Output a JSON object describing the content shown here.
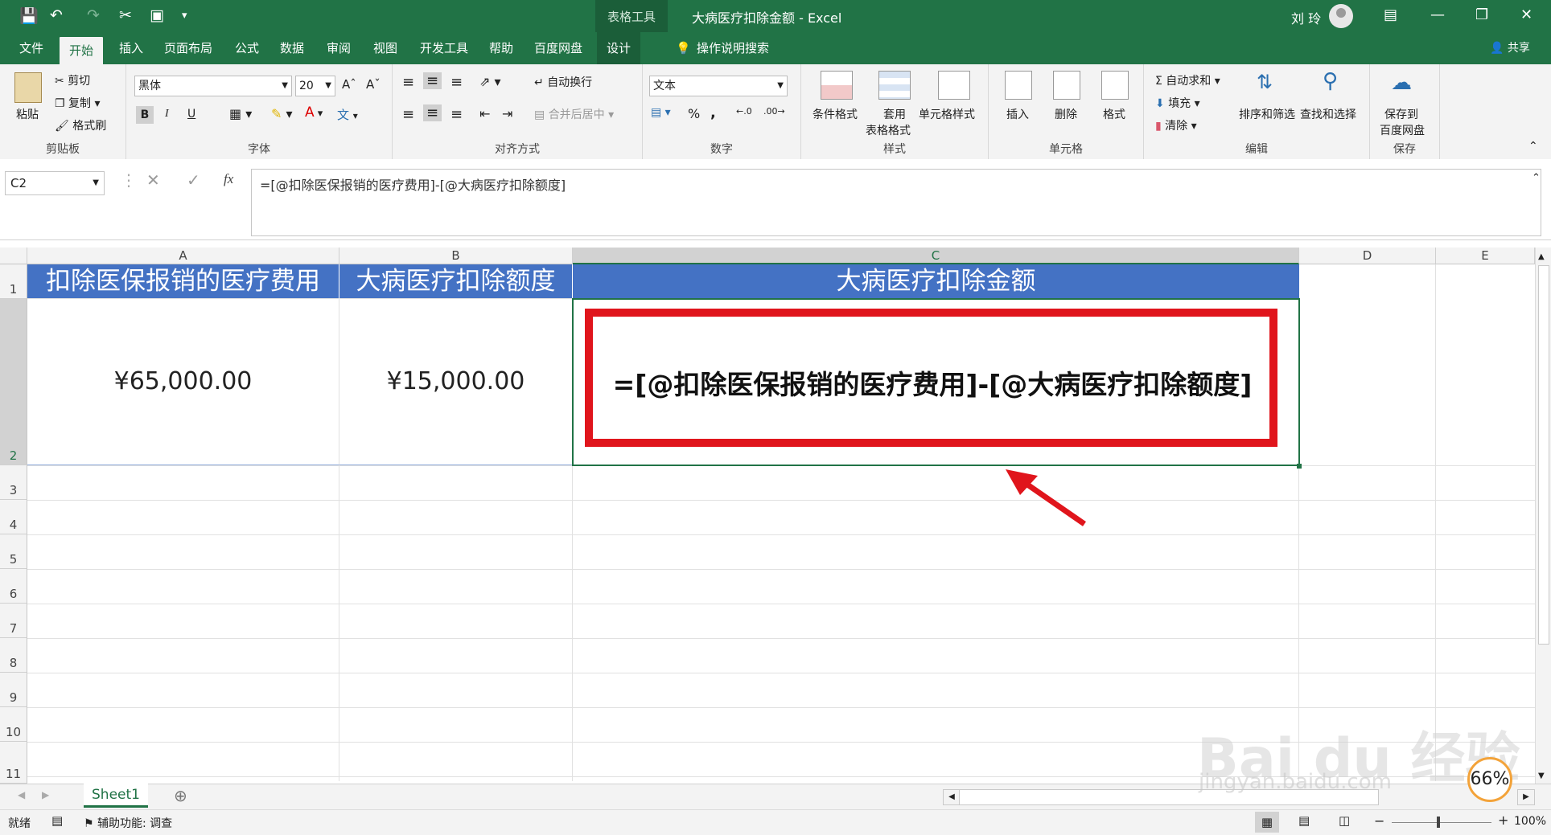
{
  "titlebar": {
    "context_tab": "表格工具",
    "title": "大病医疗扣除金额  -  Excel",
    "user": "刘 玲"
  },
  "tabs": [
    "文件",
    "开始",
    "插入",
    "页面布局",
    "公式",
    "数据",
    "审阅",
    "视图",
    "开发工具",
    "帮助",
    "百度网盘",
    "设计"
  ],
  "tell_me": "操作说明搜索",
  "share": "共享",
  "ribbon": {
    "clipboard": {
      "paste": "粘贴",
      "cut": "剪切",
      "copy": "复制",
      "format_painter": "格式刷",
      "label": "剪贴板"
    },
    "font": {
      "font_name": "黑体",
      "font_size": "20",
      "bold": "B",
      "italic": "I",
      "underline": "U",
      "label": "字体"
    },
    "alignment": {
      "wrap": "自动换行",
      "merge": "合并后居中",
      "label": "对齐方式"
    },
    "number": {
      "format": "文本",
      "percent": "%",
      "comma": ",",
      "label": "数字"
    },
    "styles": {
      "conditional": "条件格式",
      "table_fmt_1": "套用",
      "table_fmt_2": "表格格式",
      "cell_styles": "单元格样式",
      "label": "样式"
    },
    "cells": {
      "insert": "插入",
      "delete": "删除",
      "format": "格式",
      "label": "单元格"
    },
    "editing": {
      "autosum": "自动求和",
      "fill": "填充",
      "clear": "清除",
      "sort": "排序和筛选",
      "find": "查找和选择",
      "label": "编辑"
    },
    "save": {
      "line1": "保存到",
      "line2": "百度网盘",
      "label": "保存"
    }
  },
  "formula_bar": {
    "name_box": "C2",
    "fx": "fx",
    "formula": "=[@扣除医保报销的医疗费用]-[@大病医疗扣除额度]"
  },
  "columns": [
    "A",
    "B",
    "C",
    "D",
    "E"
  ],
  "rows": [
    "1",
    "2",
    "3",
    "4",
    "5",
    "6",
    "7",
    "8",
    "9",
    "10",
    "11"
  ],
  "table": {
    "headers": [
      "扣除医保报销的医疗费用",
      "大病医疗扣除额度",
      "大病医疗扣除金额"
    ],
    "row2": [
      "¥65,000.00",
      "¥15,000.00",
      "=[@扣除医保报销的医疗费用]-[@大病医疗扣除额度]"
    ]
  },
  "sheets": [
    "Sheet1"
  ],
  "status": {
    "ready": "就绪",
    "accessibility": "辅助功能: 调查",
    "zoom": "100%"
  },
  "watermark": {
    "brand": "Bai du 经验",
    "url": "jingyan.baidu.com",
    "badge": "66%"
  },
  "colors": {
    "excel_green": "#217346",
    "table_header": "#4472c4",
    "highlight_red": "#e0151c"
  }
}
